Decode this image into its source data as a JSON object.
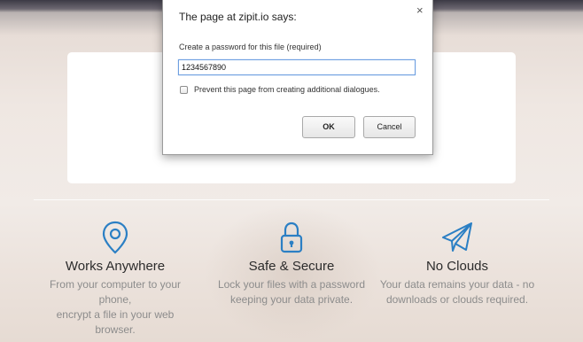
{
  "dialog": {
    "title": "The page at zipit.io says:",
    "close_glyph": "×",
    "prompt": "Create a password for this file (required)",
    "input_value": "1234567890",
    "checkbox_label": "Prevent this page from creating additional dialogues.",
    "checkbox_checked": false,
    "ok_label": "OK",
    "cancel_label": "Cancel"
  },
  "features": [
    {
      "icon": "location-pin-icon",
      "title": "Works Anywhere",
      "desc_line1": "From your computer to your",
      "desc_line2": "phone,",
      "desc_line3": "encrypt a file in your web",
      "desc_line4": "browser."
    },
    {
      "icon": "lock-icon",
      "title": "Safe & Secure",
      "desc_line1": "Lock your files with a password",
      "desc_line2": "keeping your data private."
    },
    {
      "icon": "paper-plane-icon",
      "title": "No Clouds",
      "desc_line1": "Your data remains your data - no",
      "desc_line2": "downloads or clouds required."
    }
  ],
  "colors": {
    "icon_blue": "#2b7fc4",
    "input_focus": "#6fa0e0"
  }
}
